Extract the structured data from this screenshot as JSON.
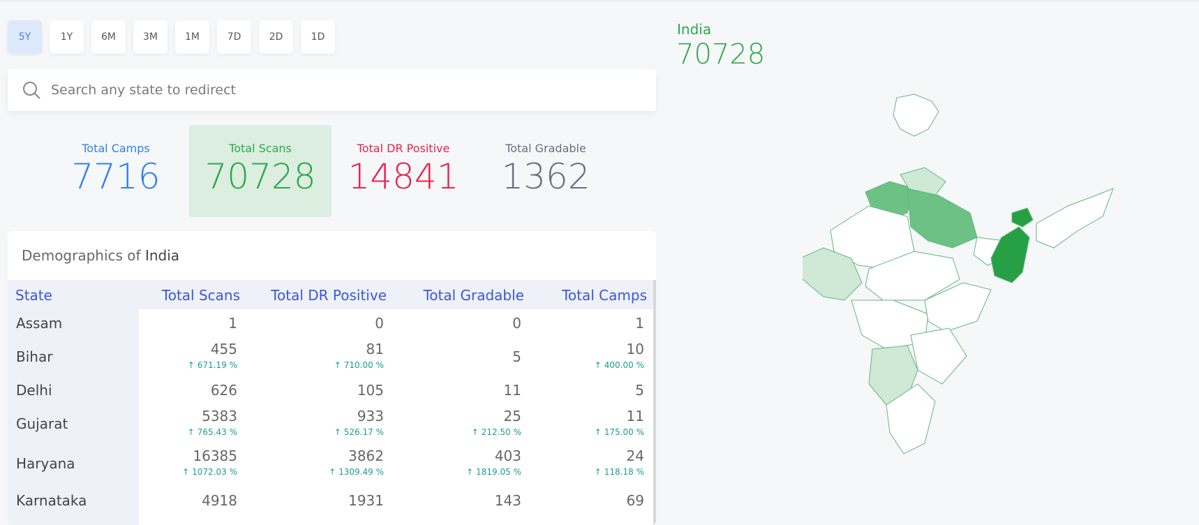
{
  "range_buttons": [
    "5Y",
    "1Y",
    "6M",
    "3M",
    "1M",
    "7D",
    "2D",
    "1D"
  ],
  "active_range": "5Y",
  "search": {
    "placeholder": "Search any state to redirect"
  },
  "stats": [
    {
      "label": "Total Camps",
      "value": "7716",
      "color": "#2f80ed"
    },
    {
      "label": "Total Scans",
      "value": "70728",
      "color": "#2ea84a"
    },
    {
      "label": "Total DR Positive",
      "value": "14841",
      "color": "#e8224f"
    },
    {
      "label": "Total Gradable",
      "value": "1362",
      "color": "#6b6f7a"
    }
  ],
  "demographics": {
    "title_prefix": "Demographics of",
    "region": "India",
    "headers": [
      "State",
      "Total Scans",
      "Total DR Positive",
      "Total Gradable",
      "Total Camps"
    ],
    "rows": [
      {
        "state": "Assam",
        "cells": [
          {
            "v": "1"
          },
          {
            "v": "0"
          },
          {
            "v": "0"
          },
          {
            "v": "1"
          }
        ]
      },
      {
        "state": "Bihar",
        "cells": [
          {
            "v": "455",
            "c": "671.19 %"
          },
          {
            "v": "81",
            "c": "710.00 %"
          },
          {
            "v": "5"
          },
          {
            "v": "10",
            "c": "400.00 %"
          }
        ]
      },
      {
        "state": "Delhi",
        "cells": [
          {
            "v": "626"
          },
          {
            "v": "105"
          },
          {
            "v": "11"
          },
          {
            "v": "5"
          }
        ]
      },
      {
        "state": "Gujarat",
        "cells": [
          {
            "v": "5383",
            "c": "765.43 %"
          },
          {
            "v": "933",
            "c": "526.17 %"
          },
          {
            "v": "25",
            "c": "212.50 %"
          },
          {
            "v": "11",
            "c": "175.00 %"
          }
        ]
      },
      {
        "state": "Haryana",
        "cells": [
          {
            "v": "16385",
            "c": "1072.03 %"
          },
          {
            "v": "3862",
            "c": "1309.49 %"
          },
          {
            "v": "403",
            "c": "1819.05 %"
          },
          {
            "v": "24",
            "c": "118.18 %"
          }
        ]
      },
      {
        "state": "Karnataka",
        "cells": [
          {
            "v": "4918"
          },
          {
            "v": "1931"
          },
          {
            "v": "143"
          },
          {
            "v": "69"
          }
        ]
      }
    ]
  },
  "map": {
    "label": "India",
    "value": "70728",
    "colors": {
      "dark": "#27a045",
      "mid": "#6cc285",
      "light": "#cfe9d6",
      "outline": "#62b679"
    }
  }
}
